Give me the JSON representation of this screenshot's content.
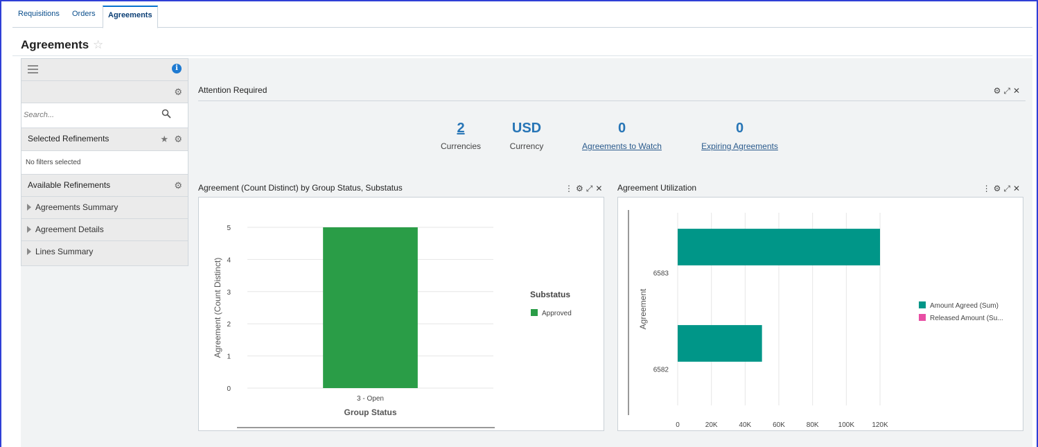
{
  "tabs": [
    {
      "label": "Requisitions"
    },
    {
      "label": "Orders"
    },
    {
      "label": "Agreements"
    }
  ],
  "page": {
    "title": "Agreements"
  },
  "left_panel": {
    "search_placeholder": "Search...",
    "selected_refinements": {
      "label": "Selected Refinements",
      "empty_text": "No filters selected"
    },
    "available_refinements": {
      "label": "Available Refinements",
      "items": [
        {
          "label": "Agreements Summary"
        },
        {
          "label": "Agreement Details"
        },
        {
          "label": "Lines Summary"
        }
      ]
    }
  },
  "attention": {
    "title": "Attention Required",
    "metrics": [
      {
        "value": "2",
        "label": "Currencies"
      },
      {
        "value": "USD",
        "label": "Currency"
      },
      {
        "value": "0",
        "label": "Agreements to Watch"
      },
      {
        "value": "0",
        "label": "Expiring Agreements"
      }
    ]
  },
  "panels": {
    "left_title": "Agreement (Count Distinct) by Group Status, Substatus",
    "right_title": "Agreement Utilization"
  },
  "colors": {
    "accent": "#0572ce",
    "green": "#2a9d47",
    "teal": "#009688",
    "pink": "#e84ea4"
  },
  "chart_data": [
    {
      "type": "bar",
      "categories": [
        "3 - Open"
      ],
      "series": [
        {
          "name": "Approved",
          "values": [
            5
          ]
        }
      ],
      "xlabel": "Group Status",
      "ylabel": "Agreement (Count Distinct)",
      "ylim": [
        0,
        5
      ],
      "yticks": [
        "0",
        "1",
        "2",
        "3",
        "4",
        "5"
      ],
      "legend_title": "Substatus",
      "legend": "right",
      "grid": true
    },
    {
      "type": "bar",
      "orientation": "horizontal",
      "categories": [
        "6583",
        "6582"
      ],
      "series": [
        {
          "name": "Amount Agreed (Sum)",
          "values": [
            120000,
            50000
          ]
        },
        {
          "name": "Released Amount (Su...",
          "values": [
            0,
            0
          ]
        }
      ],
      "ylabel": "Agreement",
      "xlim": [
        0,
        120000
      ],
      "xticks": [
        "0",
        "20K",
        "40K",
        "60K",
        "80K",
        "100K",
        "120K"
      ],
      "legend": "right",
      "grid": true
    }
  ]
}
